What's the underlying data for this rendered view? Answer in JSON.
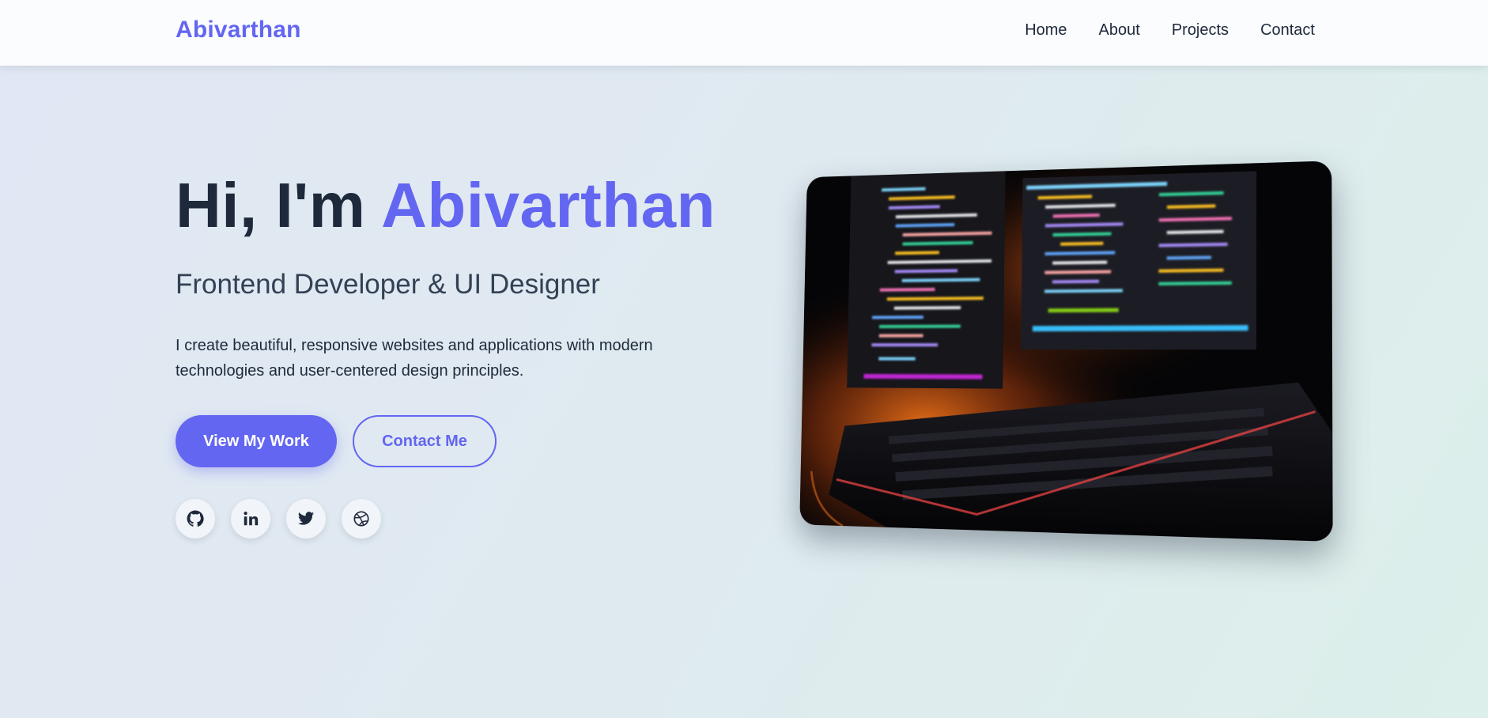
{
  "header": {
    "logo": "Abivarthan",
    "nav": [
      {
        "label": "Home"
      },
      {
        "label": "About"
      },
      {
        "label": "Projects"
      },
      {
        "label": "Contact"
      }
    ]
  },
  "hero": {
    "greeting": "Hi, I'm",
    "name": "Abivarthan",
    "subtitle": "Frontend Developer & UI Designer",
    "description": "I create beautiful, responsive websites and applications with modern technologies and user-centered design principles.",
    "primary_button": "View My Work",
    "secondary_button": "Contact Me",
    "socials": [
      {
        "icon": "github-icon"
      },
      {
        "icon": "linkedin-icon"
      },
      {
        "icon": "twitter-icon"
      },
      {
        "icon": "dribbble-icon"
      }
    ],
    "image": "monitors-with-code-and-keyboard"
  },
  "colors": {
    "accent": "#6366f1",
    "text": "#1e293b",
    "nav_bg": "#fbfcfe"
  }
}
